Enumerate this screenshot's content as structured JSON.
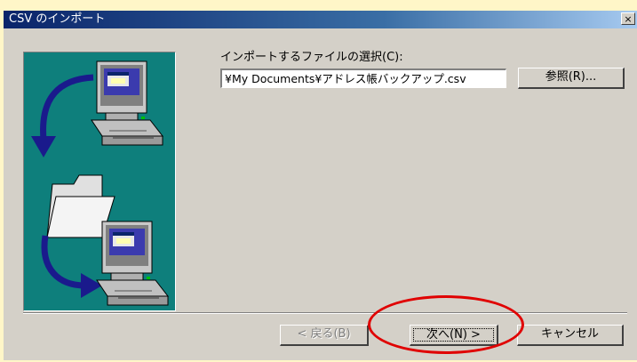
{
  "window": {
    "title": "CSV のインポート",
    "close_label": "×"
  },
  "form": {
    "select_label": "インポートするファイルの選択(C):",
    "path_value": "¥My Documents¥アドレス帳バックアップ.csv",
    "browse_label": "参照(R)..."
  },
  "buttons": {
    "back_label": "< 戻る(B)",
    "next_label": "次へ(N) >",
    "cancel_label": "キャンセル"
  },
  "colors": {
    "panel_teal": "#0E7F7C",
    "highlight": "#E00000",
    "titlebar": "#0A246A"
  },
  "icons": {
    "close": "close-icon",
    "computer": "computer-icon",
    "folder": "folder-icon",
    "arrow": "curved-arrow-icon"
  }
}
